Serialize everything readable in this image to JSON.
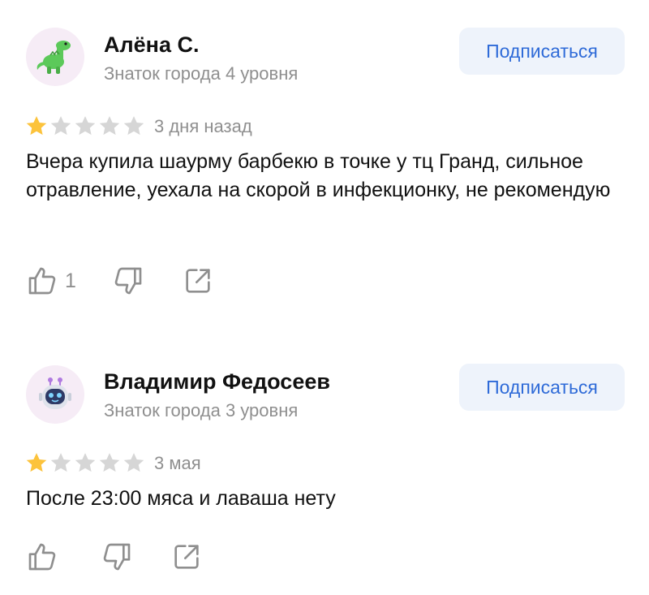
{
  "reviews": [
    {
      "author": "Алёна С.",
      "level": "Знаток города 4 уровня",
      "subscribe_label": "Подписаться",
      "avatar_icon": "dinosaur-icon",
      "avatar_bg": "#f6ecf6",
      "rating": 1,
      "date": "3 дня назад",
      "text": "Вчера купила шаурму барбекю в точке у тц Гранд, сильное отравление, уехала на скорой в инфекционку, не рекомендую",
      "likes": "1"
    },
    {
      "author": "Владимир Федосеев",
      "level": "Знаток города 3 уровня",
      "subscribe_label": "Подписаться",
      "avatar_icon": "robot-icon",
      "avatar_bg": "#f6ecf6",
      "rating": 1,
      "date": "3 мая",
      "text": "После 23:00 мяса и лаваша нету",
      "likes": ""
    }
  ],
  "colors": {
    "accent": "#2f6bd8",
    "subscribe_bg": "#eef3fb",
    "star_filled": "#fcc33c",
    "star_empty": "#d6d6d6",
    "muted_text": "#8f8f8f"
  }
}
